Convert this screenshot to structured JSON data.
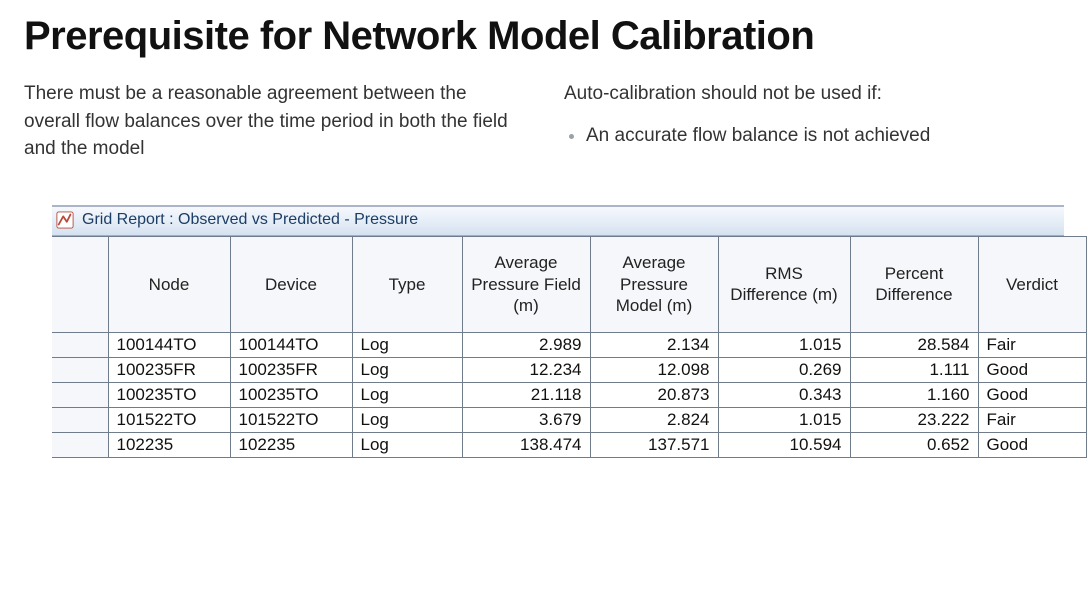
{
  "title": "Prerequisite for Network Model Calibration",
  "left_paragraph": "There must be a reasonable agreement between the overall flow balances over the time period in both the field and the model",
  "right_intro": "Auto-calibration should not be used if:",
  "right_bullets": [
    "An accurate flow balance is not achieved"
  ],
  "report": {
    "window_title": "Grid Report : Observed vs Predicted - Pressure",
    "headers": {
      "node": "Node",
      "device": "Device",
      "type": "Type",
      "avg_field": "Average Pressure Field (m)",
      "avg_model": "Average Pressure Model (m)",
      "rms": "RMS Difference (m)",
      "pct": "Percent Difference",
      "verdict": "Verdict"
    },
    "rows": [
      {
        "node": "100144TO",
        "device": "100144TO",
        "type": "Log",
        "avg_field": "2.989",
        "avg_model": "2.134",
        "rms": "1.015",
        "pct": "28.584",
        "verdict": "Fair"
      },
      {
        "node": "100235FR",
        "device": "100235FR",
        "type": "Log",
        "avg_field": "12.234",
        "avg_model": "12.098",
        "rms": "0.269",
        "pct": "1.111",
        "verdict": "Good"
      },
      {
        "node": "100235TO",
        "device": "100235TO",
        "type": "Log",
        "avg_field": "21.118",
        "avg_model": "20.873",
        "rms": "0.343",
        "pct": "1.160",
        "verdict": "Good"
      },
      {
        "node": "101522TO",
        "device": "101522TO",
        "type": "Log",
        "avg_field": "3.679",
        "avg_model": "2.824",
        "rms": "1.015",
        "pct": "23.222",
        "verdict": "Fair"
      },
      {
        "node": "102235",
        "device": "102235",
        "type": "Log",
        "avg_field": "138.474",
        "avg_model": "137.571",
        "rms": "10.594",
        "pct": "0.652",
        "verdict": "Good"
      }
    ]
  },
  "chart_data": {
    "type": "table",
    "title": "Grid Report : Observed vs Predicted - Pressure",
    "columns": [
      "Node",
      "Device",
      "Type",
      "Average Pressure Field (m)",
      "Average Pressure Model (m)",
      "RMS Difference (m)",
      "Percent Difference",
      "Verdict"
    ],
    "rows": [
      [
        "100144TO",
        "100144TO",
        "Log",
        2.989,
        2.134,
        1.015,
        28.584,
        "Fair"
      ],
      [
        "100235FR",
        "100235FR",
        "Log",
        12.234,
        12.098,
        0.269,
        1.111,
        "Good"
      ],
      [
        "100235TO",
        "100235TO",
        "Log",
        21.118,
        20.873,
        0.343,
        1.16,
        "Good"
      ],
      [
        "101522TO",
        "101522TO",
        "Log",
        3.679,
        2.824,
        1.015,
        23.222,
        "Fair"
      ],
      [
        "102235",
        "102235",
        "Log",
        138.474,
        137.571,
        10.594,
        0.652,
        "Good"
      ]
    ]
  }
}
